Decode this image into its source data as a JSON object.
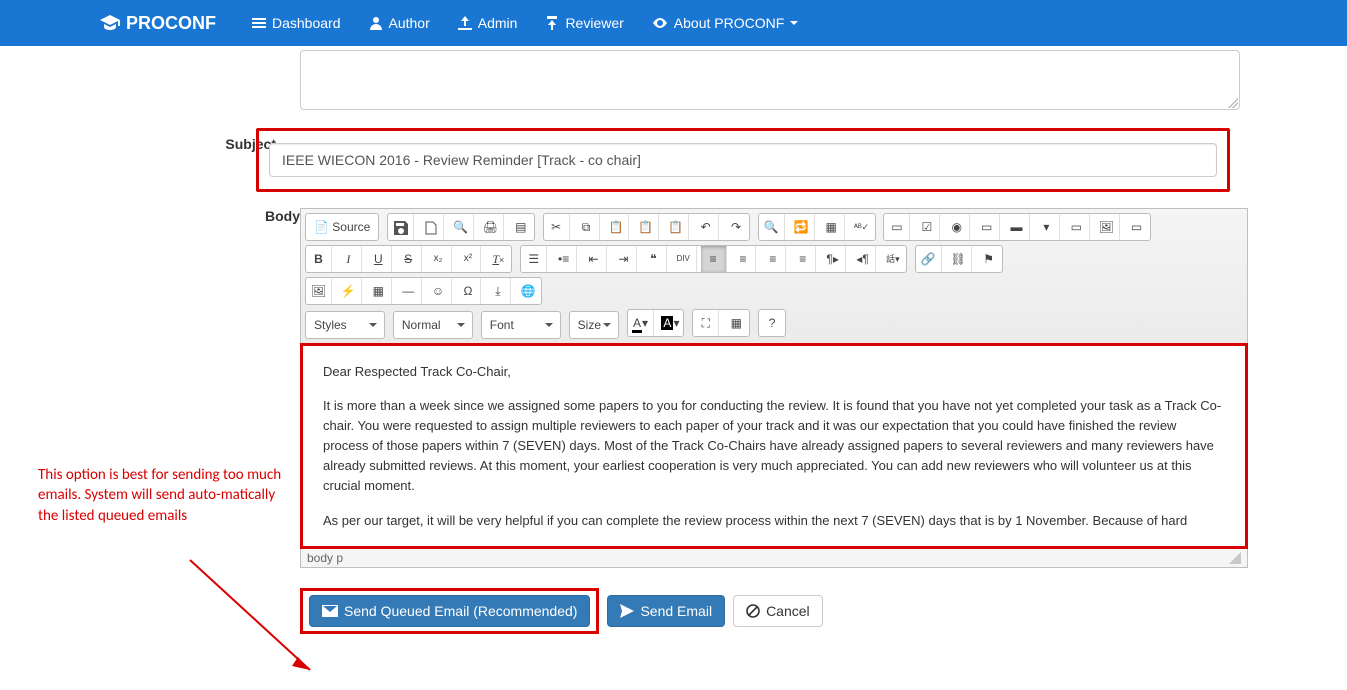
{
  "brand": "PROCONF",
  "nav": {
    "dashboard": "Dashboard",
    "author": "Author",
    "admin": "Admin",
    "reviewer": "Reviewer",
    "about": "About PROCONF"
  },
  "labels": {
    "subject": "Subject",
    "body": "Body"
  },
  "subject_value": "IEEE WIECON 2016 - Review Reminder [Track - co chair]",
  "toolbar": {
    "source": "Source",
    "styles": "Styles",
    "format": "Normal",
    "font": "Font",
    "size": "Size",
    "help": "?"
  },
  "email_body": {
    "p1": "Dear Respected Track Co-Chair,",
    "p2": "It is more than a week since we assigned some papers to you for conducting the review. It is found that you have not yet completed your task as a Track Co-chair. You were requested to assign multiple reviewers to each paper of your track and it was our expectation that you could have finished the review process of those papers within 7 (SEVEN) days. Most of the Track Co-Chairs have already assigned papers to several reviewers and many reviewers have already submitted reviews. At this moment, your earliest cooperation is very much appreciated. You can add new reviewers who will volunteer us at this crucial moment.",
    "p3": "As per our target, it will be very helpful if you can complete the review process within the next 7 (SEVEN) days that is by 1 November. Because of hard"
  },
  "elements_path": "body   p",
  "buttons": {
    "send_queued": "Send Queued Email (Recommended)",
    "send_email": "Send Email",
    "cancel": "Cancel"
  },
  "annotation": "This option is best for sending too much emails. System will send auto-matically the listed queued emails"
}
